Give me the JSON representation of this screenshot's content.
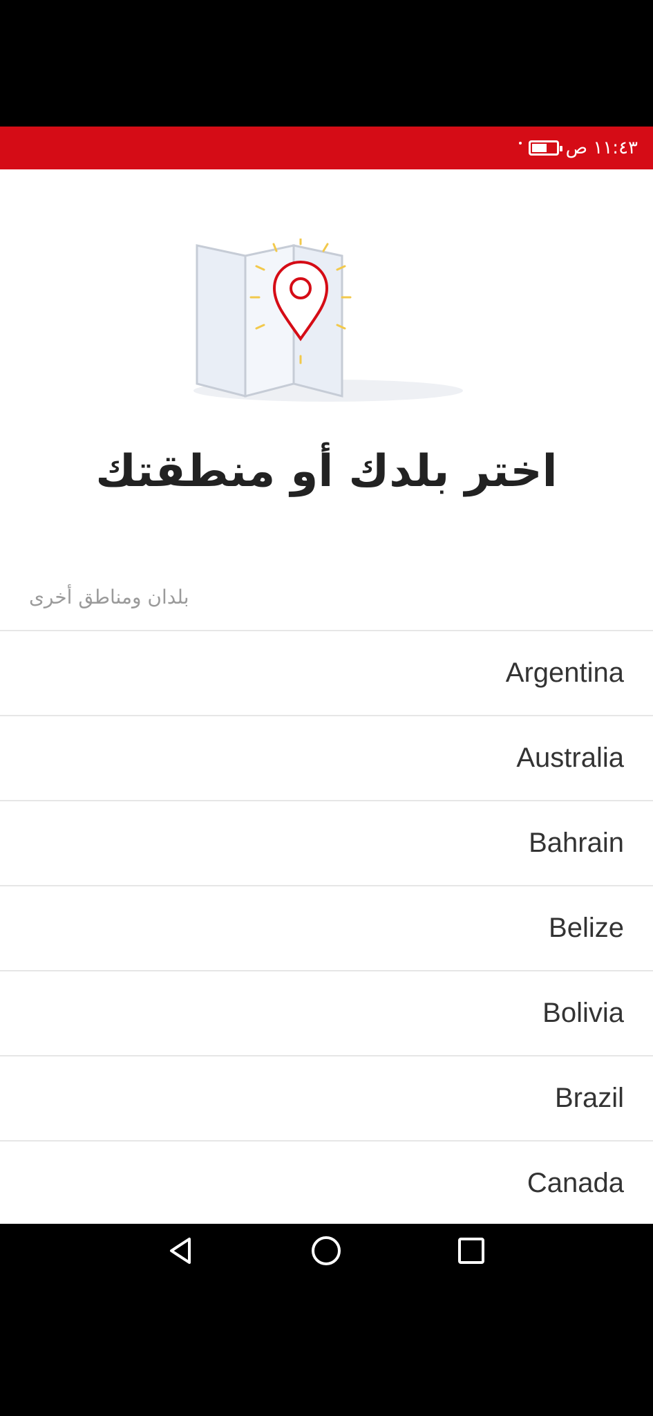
{
  "status_bar": {
    "time": "١١:٤٣ ص",
    "battery_level": 0.55,
    "background_color": "#d50c16"
  },
  "illustration": {
    "icon": "map-with-location-pin-icon",
    "pin_color": "#d50c16"
  },
  "title": "اختر بلدك أو منطقتك",
  "section_label": "بلدان ومناطق أخرى",
  "countries": [
    {
      "name": "Argentina"
    },
    {
      "name": "Australia"
    },
    {
      "name": "Bahrain"
    },
    {
      "name": "Belize"
    },
    {
      "name": "Bolivia"
    },
    {
      "name": "Brazil"
    },
    {
      "name": "Canada"
    }
  ],
  "nav_bar": {
    "back_icon": "back-triangle-icon",
    "home_icon": "home-circle-icon",
    "recents_icon": "recents-square-icon"
  }
}
